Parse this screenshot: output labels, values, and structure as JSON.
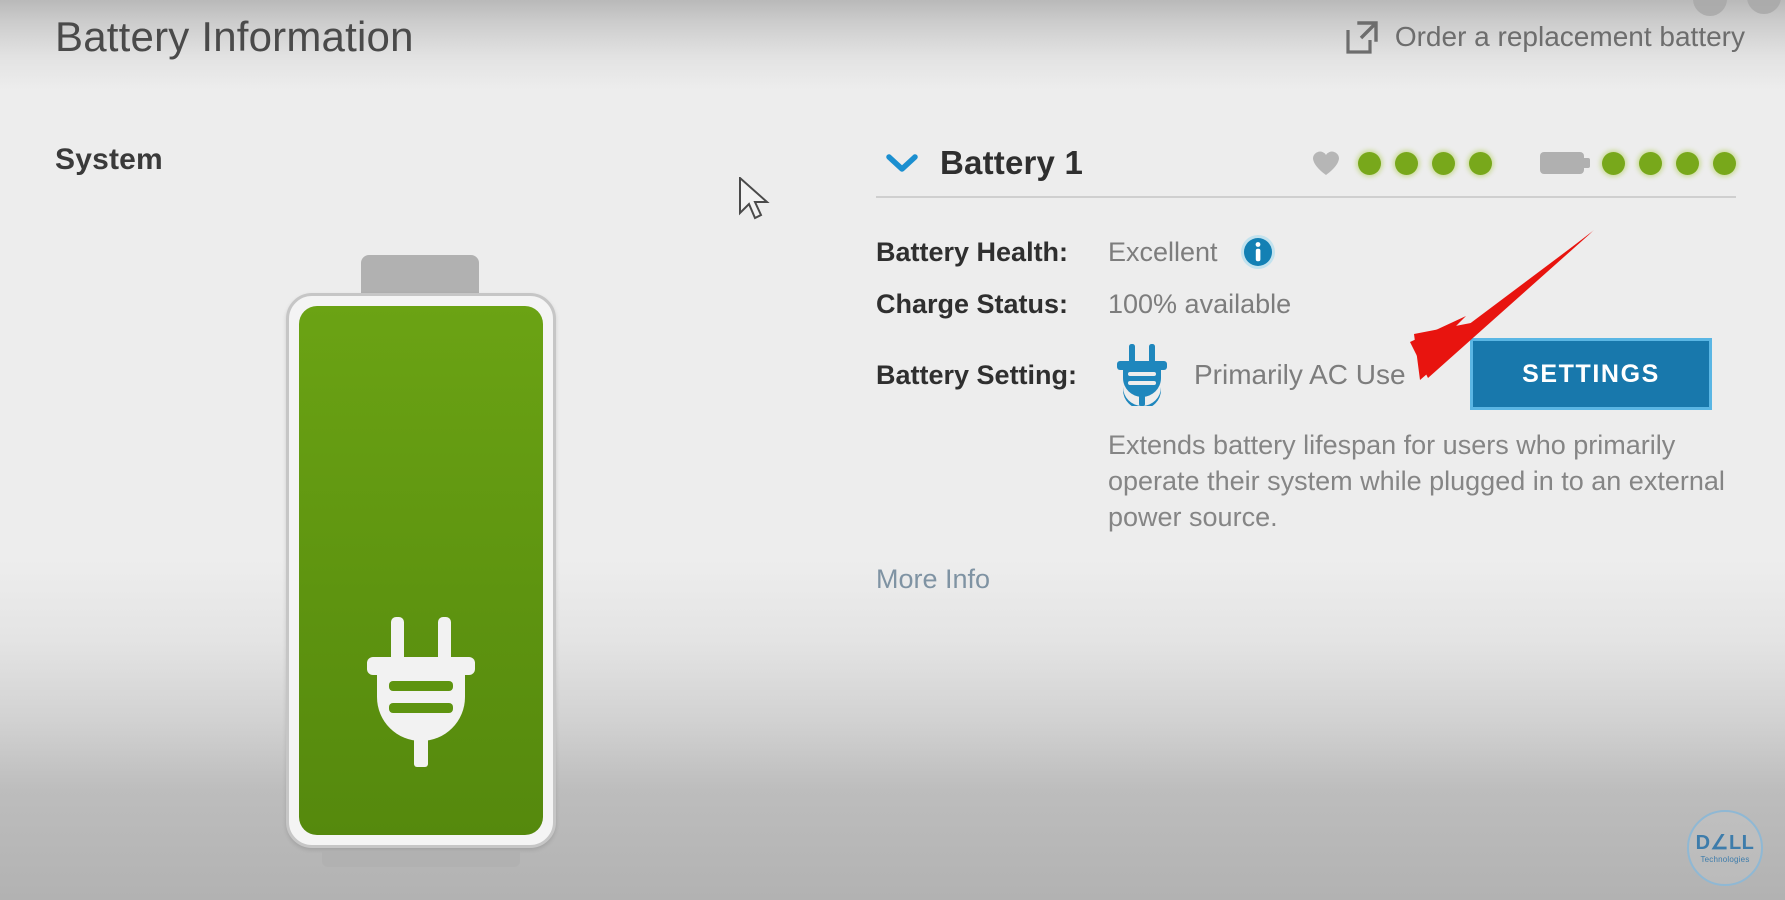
{
  "header": {
    "title": "Battery Information",
    "order_link_label": "Order a replacement battery",
    "order_link_icon": "external-link-icon"
  },
  "left": {
    "section_label": "System",
    "battery_graphic": {
      "icon": "battery-full-charging-icon",
      "fill_percent": 100,
      "fill_color": "#5e9410",
      "inner_icon": "power-plug-icon"
    }
  },
  "panel": {
    "expander_icon": "chevron-down-icon",
    "title": "Battery 1",
    "health_rating": {
      "icon": "heart-icon",
      "filled": 4,
      "total": 4,
      "dot_color": "#78a81b"
    },
    "charge_rating": {
      "icon": "battery-icon",
      "filled": 4,
      "total": 4,
      "dot_color": "#78a81b"
    },
    "rows": [
      {
        "label": "Battery Health:",
        "value": "Excellent",
        "info_icon": "info-icon"
      },
      {
        "label": "Charge Status:",
        "value": "100% available"
      }
    ],
    "setting": {
      "label": "Battery Setting:",
      "icon": "power-plug-icon",
      "value": "Primarily AC Use",
      "button_label": "SETTINGS",
      "button_color": "#1878ac",
      "description": "Extends battery lifespan for users who primarily operate their system while plugged in to an external power source."
    },
    "more_info_label": "More Info"
  },
  "annotation": {
    "arrow_color": "#e8140f",
    "points_to": "SETTINGS"
  },
  "branding": {
    "name": "D∠LL",
    "tagline": "Technologies"
  }
}
